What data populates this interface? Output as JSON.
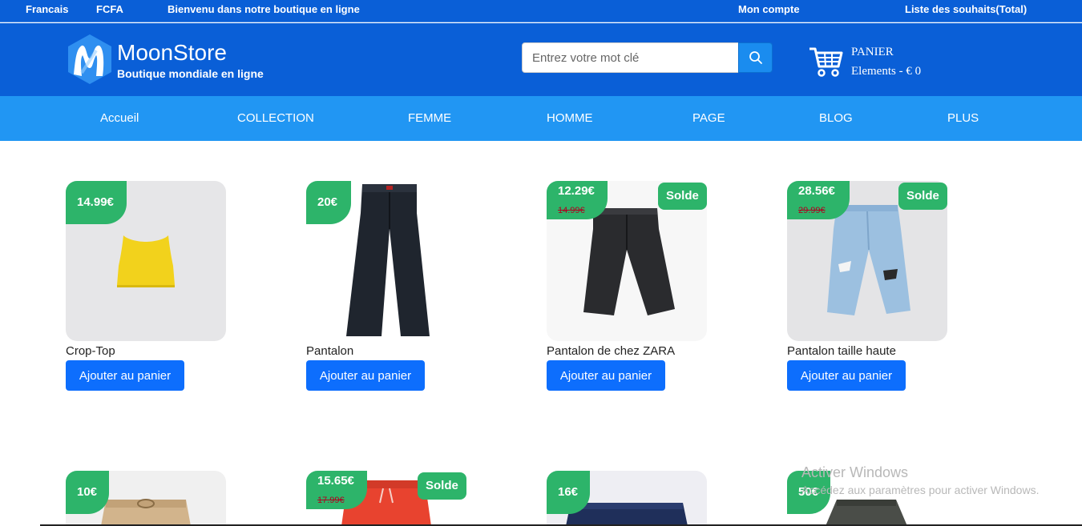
{
  "topbar": {
    "language": "Francais",
    "currency": "FCFA",
    "welcome": "Bienvenu dans notre boutique en ligne",
    "account": "Mon compte",
    "wishlist": "Liste des souhaits(Total)"
  },
  "header": {
    "brand_name": "MoonStore",
    "brand_tagline": "Boutique mondiale en ligne",
    "search_placeholder": "Entrez votre mot clé",
    "cart_title": "PANIER",
    "cart_count": "Elements - € 0"
  },
  "nav": {
    "items": [
      "Accueil",
      "COLLECTION",
      "FEMME",
      "HOMME",
      "PAGE",
      "BLOG",
      "PLUS"
    ]
  },
  "products": [
    {
      "name": "Crop-Top",
      "price": "14.99€",
      "old_price": "",
      "badge": "",
      "button": "Ajouter au panier",
      "image": "yellow-crop-top"
    },
    {
      "name": "Pantalon",
      "price": "20€",
      "old_price": "",
      "badge": "",
      "button": "Ajouter au panier",
      "image": "black-trousers"
    },
    {
      "name": "Pantalon de chez ZARA",
      "price": "12.29€",
      "old_price": "14.99€",
      "badge": "Solde",
      "button": "Ajouter au panier",
      "image": "black-cropped-jeans"
    },
    {
      "name": "Pantalon taille haute",
      "price": "28.56€",
      "old_price": "29.99€",
      "badge": "Solde",
      "button": "Ajouter au panier",
      "image": "ripped-light-jeans"
    },
    {
      "name": "",
      "price": "10€",
      "old_price": "",
      "badge": "",
      "button": "",
      "image": "beige-shorts"
    },
    {
      "name": "",
      "price": "15.65€",
      "old_price": "17.99€",
      "badge": "Solde",
      "button": "",
      "image": "red-shorts"
    },
    {
      "name": "",
      "price": "16€",
      "old_price": "",
      "badge": "",
      "button": "",
      "image": "navy-shorts"
    },
    {
      "name": "",
      "price": "50€",
      "old_price": "",
      "badge": "",
      "button": "",
      "image": "grey-skirt"
    }
  ],
  "overlay": {
    "watermark_title": "Activer Windows",
    "watermark_text": "Accédez aux paramètres pour activer Windows."
  },
  "colors": {
    "header_blue": "#0a5fd7",
    "nav_blue": "#2196f3",
    "price_green": "#2db46a",
    "button_blue": "#0d6efd"
  }
}
